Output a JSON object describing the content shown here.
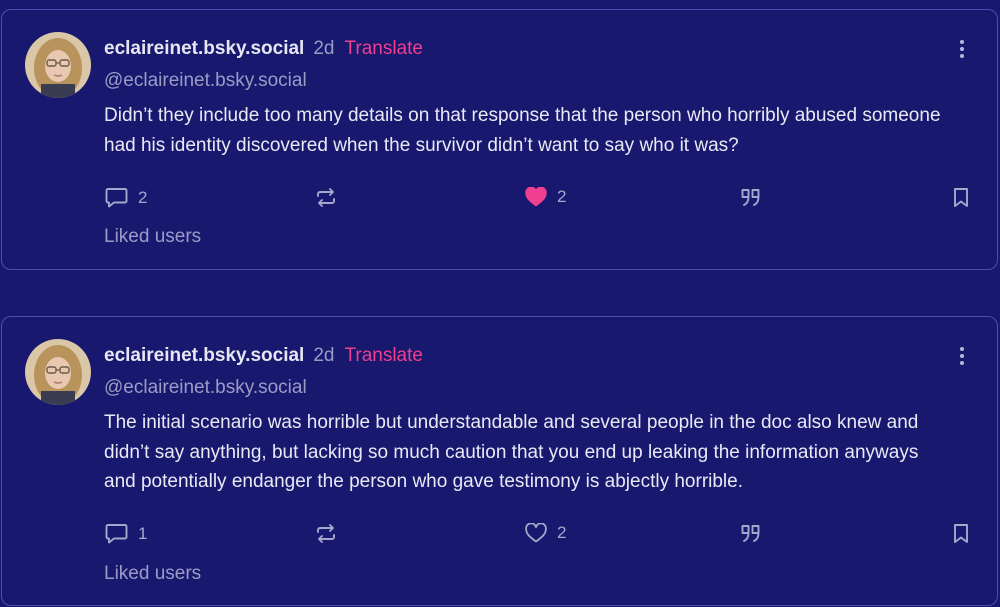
{
  "posts": [
    {
      "author_name": "eclaireinet.bsky.social",
      "time": "2d",
      "translate": "Translate",
      "handle": "@eclaireinet.bsky.social",
      "text_lines": [
        "Didn’t they include too many details on that response that the person who horribly abused someone",
        "had his identity discovered when the survivor didn’t want to say who it was?"
      ],
      "reply_count": "2",
      "like_count": "2",
      "liked": true,
      "liked_users": "Liked users"
    },
    {
      "author_name": "eclaireinet.bsky.social",
      "time": "2d",
      "translate": "Translate",
      "handle": "@eclaireinet.bsky.social",
      "text_lines": [
        "The initial scenario was horrible but understandable and several people in the doc also knew and",
        "didn’t say anything, but lacking so much caution that you end up leaking the information anyways",
        "and potentially endanger the person who gave testimony is abjectly horrible."
      ],
      "reply_count": "1",
      "like_count": "2",
      "liked": false,
      "liked_users": "Liked users"
    }
  ],
  "colors": {
    "background": "#17186e",
    "accent": "#ef3f8e",
    "muted": "#9b9cc6",
    "border": "#4b4db0"
  },
  "icons": {
    "reply": "speech-bubble-icon",
    "repost": "repost-arrows-icon",
    "like": "heart-icon",
    "quote": "quote-icon",
    "bookmark": "bookmark-icon",
    "more": "vertical-dots-icon"
  }
}
